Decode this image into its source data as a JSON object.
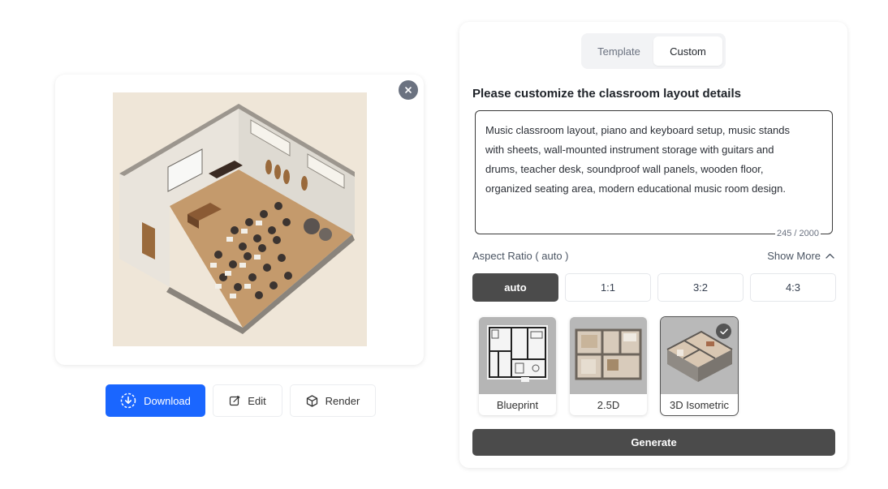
{
  "preview": {
    "close_icon": "close-icon",
    "image_alt": "isometric music classroom"
  },
  "actions": {
    "download_label": "Download",
    "edit_label": "Edit",
    "render_label": "Render",
    "accent_color": "#1a66ff"
  },
  "mode_toggle": {
    "tabs": [
      {
        "label": "Template",
        "active": false
      },
      {
        "label": "Custom",
        "active": true
      }
    ]
  },
  "form": {
    "title": "Please customize the classroom layout details",
    "prompt_value": "Music classroom layout, piano and keyboard setup, music stands\nwith sheets, wall-mounted instrument storage with guitars and\ndrums, teacher desk, soundproof wall panels, wooden floor,\norganized seating area, modern educational music room design.",
    "char_count": "245 / 2000",
    "aspect_label": "Aspect Ratio ( auto )",
    "show_more_label": "Show More",
    "ratios": [
      {
        "label": "auto",
        "active": true
      },
      {
        "label": "1:1",
        "active": false
      },
      {
        "label": "3:2",
        "active": false
      },
      {
        "label": "4:3",
        "active": false
      }
    ],
    "styles": [
      {
        "label": "Blueprint",
        "selected": false
      },
      {
        "label": "2.5D",
        "selected": false
      },
      {
        "label": "3D Isometric",
        "selected": true
      }
    ],
    "generate_label": "Generate",
    "dark_color": "#4b4b4b"
  }
}
